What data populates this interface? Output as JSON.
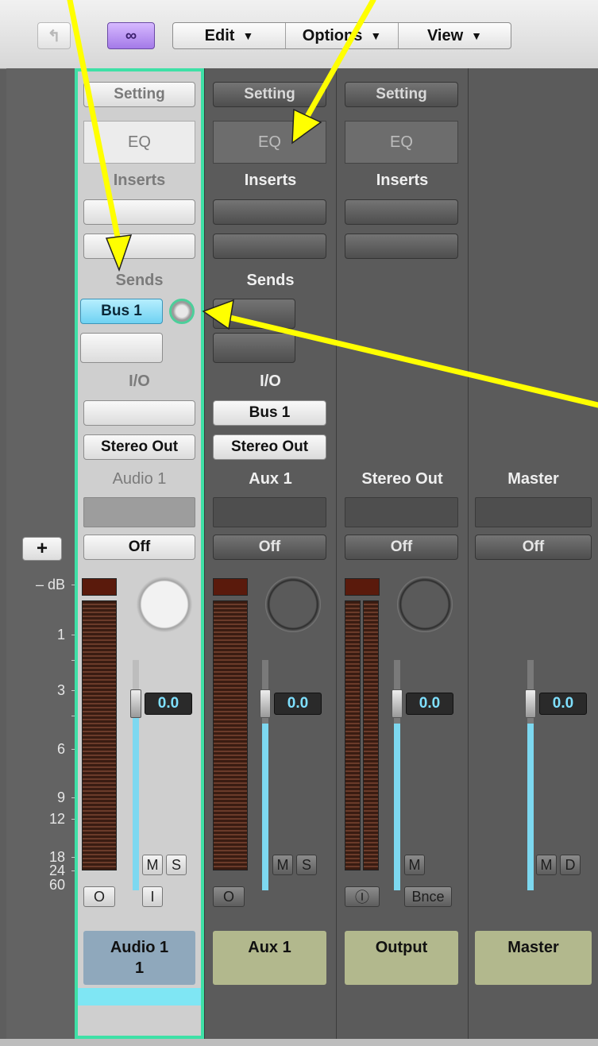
{
  "toolbar": {
    "back_icon": "back-arrow-icon",
    "link_icon": "link-icon",
    "menus": [
      {
        "label": "Edit",
        "caret": "▼"
      },
      {
        "label": "Options",
        "caret": "▼"
      },
      {
        "label": "View",
        "caret": "▼"
      }
    ]
  },
  "ruler": {
    "plus": "+",
    "labels": [
      "– dB",
      "1",
      "3",
      "6",
      "9",
      "12",
      "18",
      "24",
      "60"
    ]
  },
  "strips": [
    {
      "setting": "Setting",
      "eq": "EQ",
      "inserts_label": "Inserts",
      "sends_label": "Sends",
      "send_bus": "Bus 1",
      "io_label": "I/O",
      "output": "Stereo Out",
      "name_top": "Audio 1",
      "automation": "Off",
      "volume": "0.0",
      "mute": "M",
      "solo": "S",
      "record": "O",
      "input_monitor": "I",
      "track_name": "Audio 1",
      "track_number": "1"
    },
    {
      "setting": "Setting",
      "eq": "EQ",
      "inserts_label": "Inserts",
      "sends_label": "Sends",
      "io_label": "I/O",
      "input": "Bus 1",
      "output": "Stereo Out",
      "name_top": "Aux 1",
      "automation": "Off",
      "volume": "0.0",
      "mute": "M",
      "solo": "S",
      "record": "O",
      "track_name": "Aux 1"
    },
    {
      "setting": "Setting",
      "eq": "EQ",
      "inserts_label": "Inserts",
      "name_top": "Stereo Out",
      "automation": "Off",
      "volume": "0.0",
      "mute": "M",
      "stereo_link": "Ⓘ",
      "bounce": "Bnce",
      "track_name": "Output"
    },
    {
      "name_top": "Master",
      "automation": "Off",
      "volume": "0.0",
      "mute": "M",
      "dim": "D",
      "track_name": "Master"
    }
  ],
  "colors": {
    "selection": "#3ee0a6",
    "arrow": "#ffff00",
    "meter_value": "#7fe0ff",
    "track_audio": "#8fa8bc",
    "track_aux": "#b2b88d"
  }
}
